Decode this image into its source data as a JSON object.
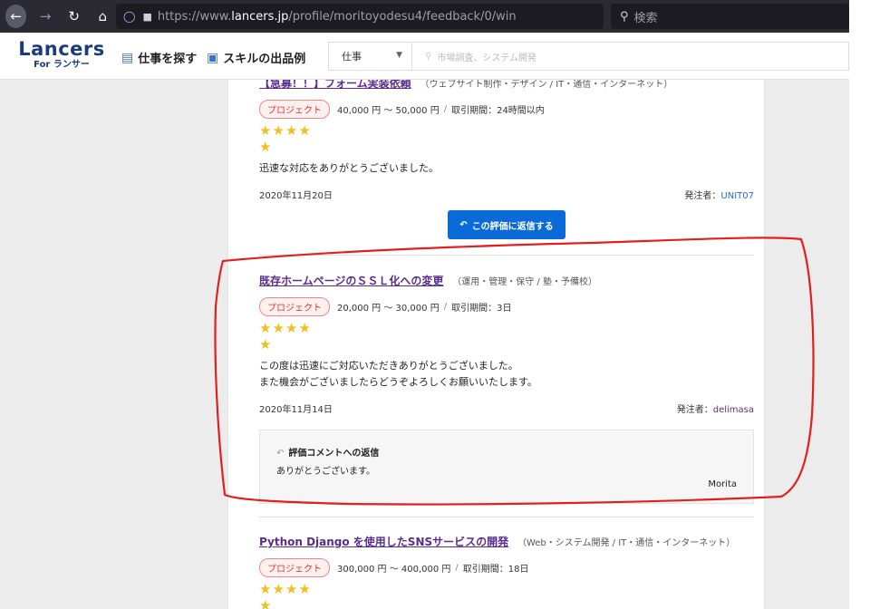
{
  "browser": {
    "url_prefix": "https://www.",
    "url_host": "lancers.jp",
    "url_path": "/profile/moritoyodesu4/feedback/0/win",
    "search_placeholder": "検索"
  },
  "header": {
    "logo_main": "Lancers",
    "logo_sub": "For ランサー",
    "nav_find_work": "仕事を探す",
    "nav_skill_examples": "スキルの出品例",
    "select_value": "仕事",
    "search_placeholder": "市場調査、システム開発"
  },
  "reviews": [
    {
      "title": "【急募！！】フォーム実装依頼",
      "category": "（ウェブサイト制作・デザイン / IT・通信・インターネット）",
      "badge": "プロジェクト",
      "price": "40,000 円 〜 50,000 円",
      "period": "取引期間：24時間以内",
      "stars_row1": "★★★★",
      "stars_row2": "★",
      "comment_line1": "迅速な対応をありがとうございました。",
      "date": "2020年11月20日",
      "orderer_label": "発注者：",
      "orderer": "UNIT07",
      "reply_button": "この評価に返信する"
    },
    {
      "title": "既存ホームページのＳＳＬ化への変更",
      "category": "（運用・管理・保守 / 塾・予備校）",
      "badge": "プロジェクト",
      "price": "20,000 円 〜 30,000 円",
      "period": "取引期間：3日",
      "stars_row1": "★★★★",
      "stars_row2": "★",
      "comment_line1": "この度は迅速にご対応いただきありがとうございました。",
      "comment_line2": "また機会がございましたらどうぞよろしくお願いいたします。",
      "date": "2020年11月14日",
      "orderer_label": "発注者：",
      "orderer": "delimasa",
      "reply_heading": "評価コメントへの返信",
      "reply_body": "ありがとうございます。",
      "reply_author": "Morita"
    },
    {
      "title": "Python Django を使用したSNSサービスの開発",
      "category": "（Web・システム開発 / IT・通信・インターネット）",
      "badge": "プロジェクト",
      "price": "300,000 円 〜 400,000 円",
      "period": "取引期間：18日",
      "stars_row1": "★★★★",
      "stars_row2": "★"
    }
  ],
  "colors": {
    "annotation": "#e02020",
    "star": "#f0c020",
    "link_purple": "#5a2d8c",
    "button_blue": "#0a6ad8"
  }
}
